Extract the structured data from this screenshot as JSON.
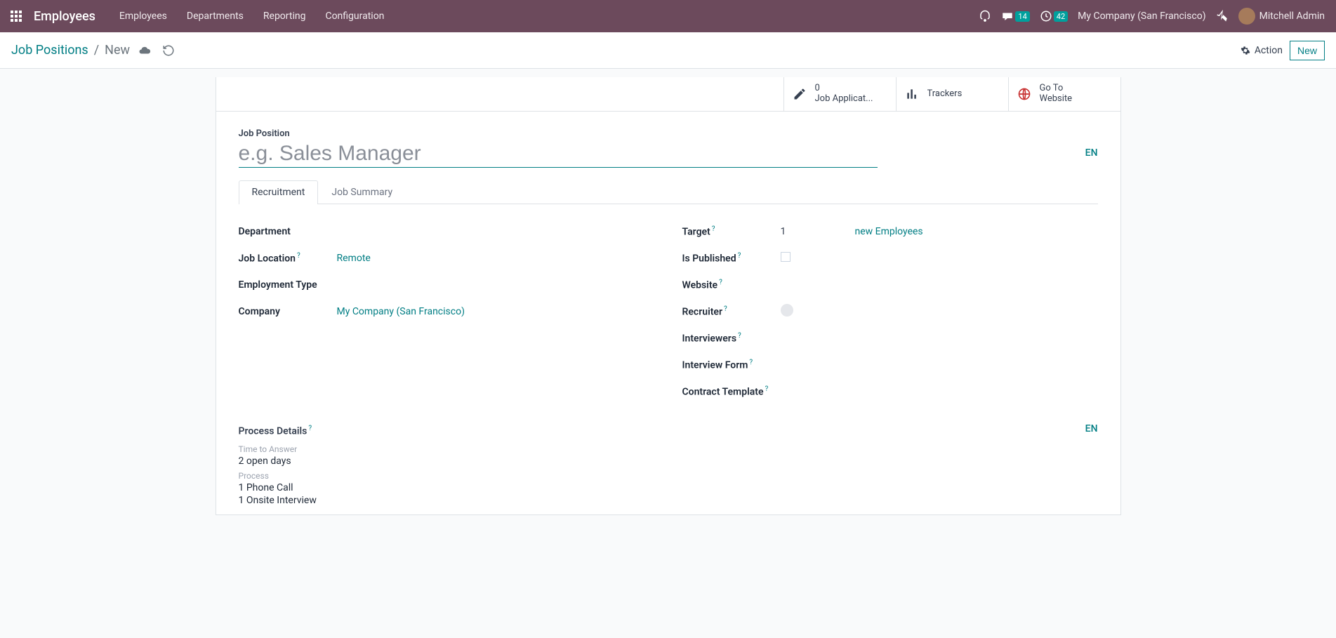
{
  "topbar": {
    "app_title": "Employees",
    "nav": [
      "Employees",
      "Departments",
      "Reporting",
      "Configuration"
    ],
    "msg_badge": "14",
    "activity_badge": "42",
    "company": "My Company (San Francisco)",
    "user": "Mitchell Admin"
  },
  "controlbar": {
    "breadcrumb_root": "Job Positions",
    "breadcrumb_current": "New",
    "action_label": "Action",
    "new_label": "New"
  },
  "stats": {
    "applications_count": "0",
    "applications_label": "Job Applicat...",
    "trackers_label": "Trackers",
    "goto_line1": "Go To",
    "goto_line2": "Website"
  },
  "form": {
    "jp_label": "Job Position",
    "jp_placeholder": "e.g. Sales Manager",
    "lang": "EN",
    "tabs": {
      "recruitment": "Recruitment",
      "summary": "Job Summary"
    },
    "left": {
      "department": "Department",
      "job_location": "Job Location",
      "job_location_val": "Remote",
      "employment_type": "Employment Type",
      "company": "Company",
      "company_val": "My Company (San Francisco)"
    },
    "right": {
      "target": "Target",
      "target_val": "1",
      "target_unit": "new Employees",
      "is_published": "Is Published",
      "website": "Website",
      "recruiter": "Recruiter",
      "interviewers": "Interviewers",
      "interview_form": "Interview Form",
      "contract_template": "Contract Template"
    },
    "process": {
      "heading": "Process Details",
      "time_label": "Time to Answer",
      "time_val": "2 open days",
      "process_label": "Process",
      "step1": "1 Phone Call",
      "step2": "1 Onsite Interview",
      "lang": "EN"
    }
  }
}
